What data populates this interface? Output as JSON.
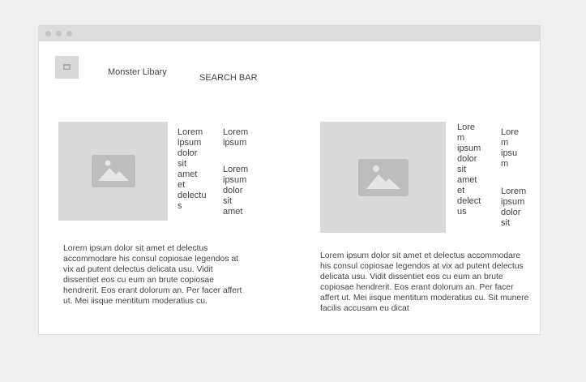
{
  "window": {
    "controls": [
      "close",
      "minimize",
      "maximize"
    ]
  },
  "header": {
    "logo_icon": "image-icon",
    "app_title": "Monster Libary",
    "search_label": "SEARCH BAR"
  },
  "cards": [
    {
      "image_icon": "image-placeholder-icon",
      "col1_text": "Lorem\nipsum\ndolor\nsit\namet\net\ndelectu\ns",
      "col2_top": "Lorem\nipsum",
      "col2_bottom": "Lorem\nipsum\ndolor\nsit\namet",
      "description": "Lorem ipsum dolor sit amet et delectus accommodare his consul copiosae legendos at vix ad putent delectus delicata usu. Vidit dissentiet eos cu eum an brute copiosae hendrerit. Eos erant dolorum an. Per facer affert ut. Mei iisque mentitum moderatius cu."
    },
    {
      "image_icon": "image-placeholder-icon",
      "col1_text": "Lore\nm\nipsum\ndolor\nsit\namet\net\ndelect\nus",
      "col2_top": "Lore\nm\nipsu\nm",
      "col2_bottom": "Lorem\nipsum\ndolor\nsit",
      "description": "Lorem ipsum dolor sit amet et delectus accommodare his consul copiosae legendos at vix ad putent delectus delicata usu. Vidit dissentiet eos cu eum an brute copiosae hendrerit. Eos erant dolorum an. Per facer affert ut. Mei iisque mentitum moderatius cu. Sit munere facilis accusam eu dicat"
    }
  ]
}
